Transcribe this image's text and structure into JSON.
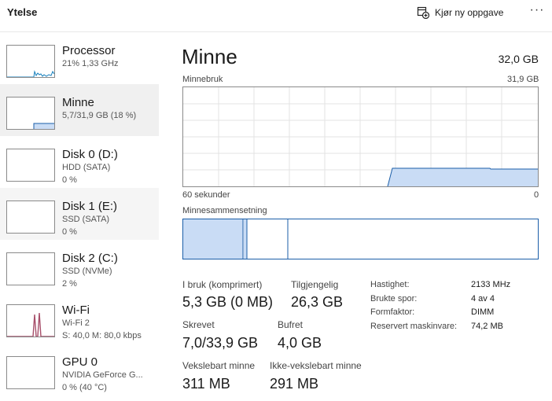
{
  "header": {
    "title": "Ytelse",
    "run_task_label": "Kjør ny oppgave",
    "more_label": "···"
  },
  "sidebar": {
    "items": [
      {
        "name": "Processor",
        "sub1": "21%  1,33 GHz",
        "sub2": ""
      },
      {
        "name": "Minne",
        "sub1": "5,7/31,9 GB (18 %)",
        "sub2": ""
      },
      {
        "name": "Disk 0 (D:)",
        "sub1": "HDD (SATA)",
        "sub2": "0 %"
      },
      {
        "name": "Disk 1 (E:)",
        "sub1": "SSD (SATA)",
        "sub2": "0 %"
      },
      {
        "name": "Disk 2 (C:)",
        "sub1": "SSD (NVMe)",
        "sub2": "2 %"
      },
      {
        "name": "Wi-Fi",
        "sub1": "Wi-Fi 2",
        "sub2": "S: 40,0  M: 80,0 kbps"
      },
      {
        "name": "GPU 0",
        "sub1": "NVIDIA GeForce G...",
        "sub2": "0 % (40 °C)"
      }
    ]
  },
  "main": {
    "title": "Minne",
    "total": "32,0 GB",
    "usage_label": "Minnebruk",
    "usage_max": "31,9 GB",
    "time_left": "60 sekunder",
    "time_right": "0",
    "composition_label": "Minnesammensetning",
    "stats": {
      "in_use_label": "I bruk (komprimert)",
      "in_use_value": "5,3 GB (0 MB)",
      "available_label": "Tilgjengelig",
      "available_value": "26,3 GB",
      "committed_label": "Skrevet",
      "committed_value": "7,0/33,9 GB",
      "cached_label": "Bufret",
      "cached_value": "4,0 GB",
      "paged_label": "Vekslebart minne",
      "paged_value": "311 MB",
      "nonpaged_label": "Ikke-vekslebart minne",
      "nonpaged_value": "291 MB"
    },
    "specs": [
      {
        "key": "Hastighet:",
        "value": "2133 MHz"
      },
      {
        "key": "Brukte spor:",
        "value": "4 av 4"
      },
      {
        "key": "Formfaktor:",
        "value": "DIMM"
      },
      {
        "key": "Reservert maskinvare:",
        "value": "74,2 MB"
      }
    ]
  },
  "colors": {
    "memory_fill": "#c9dcf5",
    "memory_line": "#1b5ea8",
    "processor_line": "#117dbb",
    "wifi_line": "#a74f6a",
    "grid": "#e3e3e3"
  }
}
